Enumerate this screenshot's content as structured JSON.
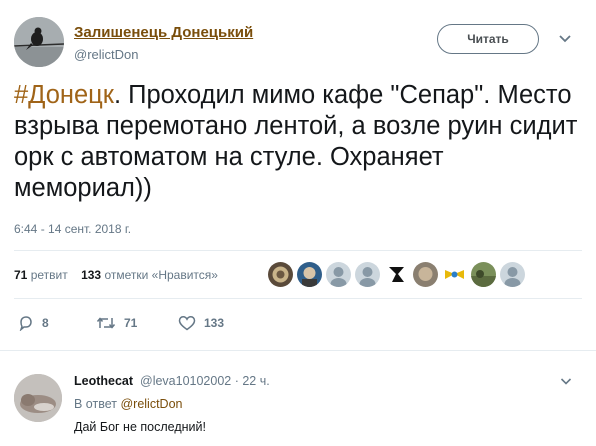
{
  "tweet": {
    "author_name": "Залишенець Донецький",
    "author_handle": "@relictDon",
    "follow_label": "Читать",
    "hashtag": "#Донецк",
    "text": ". Проходил мимо кафе \"Сепар\". Место взрыва перемотано лентой, а возле руин сидит орк с автоматом на стуле. Охраняет мемориал))",
    "timestamp": "6:44 - 14 сент. 2018 г."
  },
  "stats": {
    "retweets_count": "71",
    "retweets_label": "ретвит",
    "likes_count": "133",
    "likes_label": "отметки «Нравится»"
  },
  "actions": {
    "reply_count": "8",
    "retweet_count": "71",
    "like_count": "133"
  },
  "reply": {
    "author_name": "Leothecat",
    "meta": "@leva10102002 · 22 ч.",
    "reply_to_prefix": "В ответ",
    "reply_to_handle": "@relictDon",
    "text": "Дай Бог не последний!"
  },
  "colors": {
    "name_link": "#7a4e0b",
    "hashtag": "#a06418",
    "secondary": "#657786",
    "divider": "#e6ecf0"
  }
}
